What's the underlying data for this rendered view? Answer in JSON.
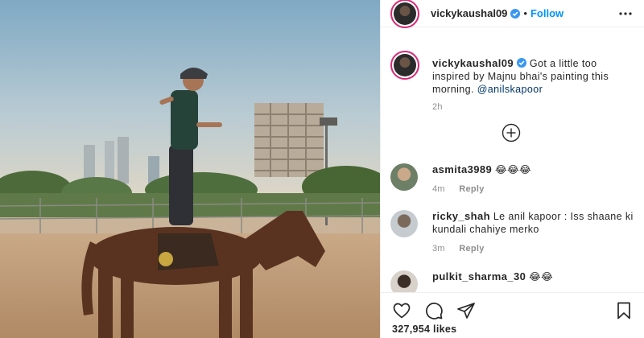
{
  "post_author": {
    "username": "vickykaushal09",
    "verified": true,
    "follow_label": "Follow",
    "separator": "•"
  },
  "caption": {
    "username": "vickykaushal09",
    "text": "Got a little too inspired by Majnu bhai's painting this morning.",
    "mention": "@anilskapoor",
    "time": "2h"
  },
  "comments": [
    {
      "username": "asmita3989",
      "text": "😂😂😂",
      "time": "4m",
      "reply_label": "Reply"
    },
    {
      "username": "ricky_shah",
      "text": "Le anil kapoor : Iss shaane ki kundali chahiye merko",
      "time": "3m",
      "reply_label": "Reply"
    },
    {
      "username": "pulkit_sharma_30",
      "text": "😂😂"
    }
  ],
  "likes_text": "327,954 likes",
  "icons": {
    "more": "more-options-icon",
    "load_more": "plus-circle-icon",
    "like": "heart-icon",
    "comment": "comment-icon",
    "share": "share-icon",
    "save": "bookmark-icon"
  },
  "colors": {
    "follow": "#0095f6",
    "verified": "#3897f0",
    "muted": "#8e8e8e",
    "mention": "#00376b"
  }
}
